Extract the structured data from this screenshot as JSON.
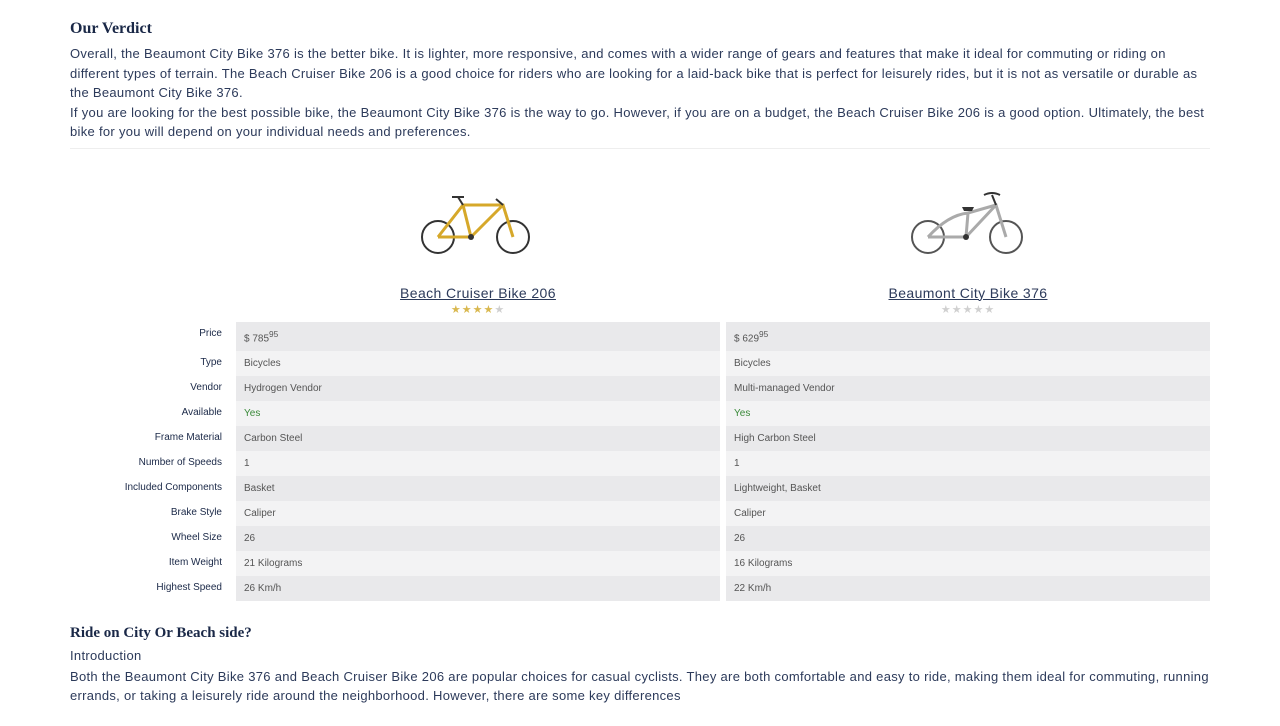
{
  "verdict": {
    "title": "Our Verdict",
    "p1": "Overall, the Beaumont City Bike 376 is the better bike. It is lighter, more responsive, and comes with a wider range of gears and features that make it ideal for commuting or riding on different types of terrain. The Beach Cruiser Bike 206 is a good choice for riders who are looking for a laid-back bike that is perfect for leisurely rides, but it is not as versatile or durable as the Beaumont City Bike 376.",
    "p2": "If you are looking for the best possible bike, the Beaumont City Bike 376 is the way to go. However, if you are on a budget, the Beach Cruiser Bike 206 is a good option. Ultimately, the best bike for you will depend on your individual needs and preferences."
  },
  "products": {
    "a": {
      "name": "Beach Cruiser Bike 206",
      "rating_filled": 4,
      "rating_total": 5
    },
    "b": {
      "name": "Beaumont City Bike 376",
      "rating_filled": 0,
      "rating_total": 5
    }
  },
  "rows": {
    "price": {
      "label": "Price",
      "a_prefix": "$ ",
      "a_main": "785",
      "a_sup": "95",
      "b_prefix": "$ ",
      "b_main": "629",
      "b_sup": "95"
    },
    "type": {
      "label": "Type",
      "a": "Bicycles",
      "b": "Bicycles"
    },
    "vendor": {
      "label": "Vendor",
      "a": "Hydrogen Vendor",
      "b": "Multi-managed Vendor"
    },
    "avail": {
      "label": "Available",
      "a": "Yes",
      "b": "Yes"
    },
    "frame": {
      "label": "Frame Material",
      "a": "Carbon Steel",
      "b": "High Carbon Steel"
    },
    "speeds": {
      "label": "Number of Speeds",
      "a": "1",
      "b": "1"
    },
    "included": {
      "label": "Included Components",
      "a": "Basket",
      "b": "Lightweight, Basket"
    },
    "brake": {
      "label": "Brake Style",
      "a": "Caliper",
      "b": "Caliper"
    },
    "wheel": {
      "label": "Wheel Size",
      "a": "26",
      "b": "26"
    },
    "weight": {
      "label": "Item Weight",
      "a": "21 Kilograms",
      "b": "16 Kilograms"
    },
    "topspeed": {
      "label": "Highest Speed",
      "a": "26 Km/h",
      "b": "22 Km/h"
    }
  },
  "bottom": {
    "title": "Ride on City Or Beach side?",
    "intro": "Introduction",
    "body": "Both the Beaumont City Bike 376 and Beach Cruiser Bike 206 are popular choices for casual cyclists. They are both comfortable and easy to ride, making them ideal for commuting, running errands, or taking a leisurely ride around the neighborhood. However, there are some key differences"
  }
}
